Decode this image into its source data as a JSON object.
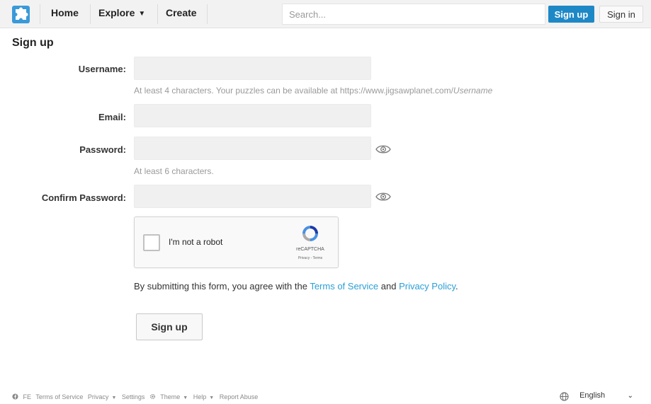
{
  "header": {
    "home_label": "Home",
    "explore_label": "Explore",
    "explore_caret": "▼",
    "create_label": "Create",
    "search_placeholder": "Search...",
    "signup_label": "Sign up",
    "signin_label": "Sign in"
  },
  "page": {
    "title": "Sign up"
  },
  "form": {
    "username_label": "Username:",
    "username_hint": "At least 4 characters. Your puzzles can be available at https://www.jigsawplanet.com/",
    "username_hint_em": "Username",
    "email_label": "Email:",
    "password_label": "Password:",
    "password_hint": "At least 6 characters.",
    "confirm_label": "Confirm Password:",
    "captcha_label": "I'm not a robot",
    "captcha_brand": "reCAPTCHA",
    "captcha_links": "Privacy - Terms",
    "agree_prefix": "By submitting this form, you agree with the ",
    "terms_link": "Terms of Service",
    "agree_and": " and ",
    "privacy_link": "Privacy Policy",
    "agree_suffix": ".",
    "submit_label": "Sign up"
  },
  "footer": {
    "fb_label": "FE",
    "terms": "Terms of Service",
    "privacy": "Privacy",
    "settings": "Settings",
    "theme": "Theme",
    "help": "Help",
    "report": "Report Abuse",
    "caret": "▼",
    "language": "English",
    "language_chevron": "⌄"
  },
  "colors": {
    "accent": "#1e88c6",
    "link": "#2a9fd6",
    "input_bg": "#f0f0f0"
  }
}
